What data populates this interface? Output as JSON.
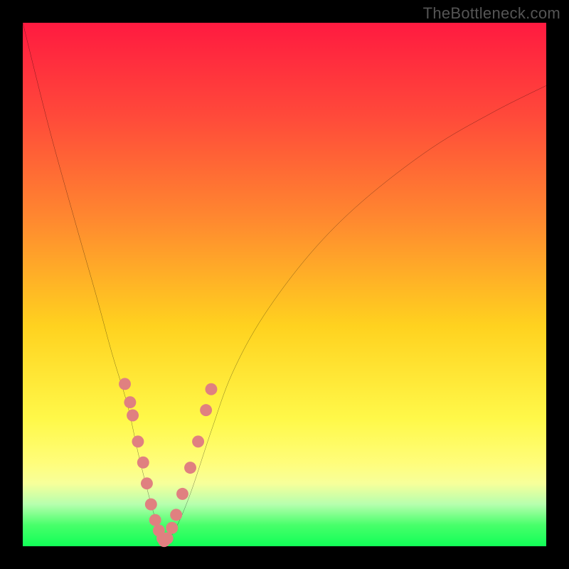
{
  "watermark": "TheBottleneck.com",
  "colors": {
    "background": "#000000",
    "curve_stroke": "#000000",
    "dot_fill": "#e08080",
    "gradient_top": "#ff1a40",
    "gradient_bottom": "#11ff57"
  },
  "chart_data": {
    "type": "line",
    "title": "",
    "xlabel": "",
    "ylabel": "",
    "xlim": [
      0,
      100
    ],
    "ylim": [
      0,
      100
    ],
    "series": [
      {
        "name": "bottleneck-curve",
        "x": [
          0,
          5,
          10,
          14,
          17,
          20,
          22,
          24,
          26,
          27,
          29,
          32,
          36,
          40,
          46,
          55,
          65,
          78,
          90,
          100
        ],
        "values": [
          100,
          80,
          62,
          48,
          37,
          27,
          18,
          10,
          3,
          1,
          3,
          10,
          22,
          33,
          44,
          56,
          66,
          76,
          83,
          88
        ]
      }
    ],
    "scatter_points": {
      "name": "highlighted-points",
      "x": [
        19.5,
        20.5,
        21,
        22,
        23,
        23.7,
        24.5,
        25.3,
        26,
        26.7,
        27,
        27.6,
        28.5,
        29.3,
        30.5,
        32,
        33.5,
        35,
        36
      ],
      "values": [
        31,
        27.5,
        25,
        20,
        16,
        12,
        8,
        5,
        3,
        1.5,
        1,
        1.5,
        3.5,
        6,
        10,
        15,
        20,
        26,
        30
      ]
    },
    "notes": "V-shaped bottleneck curve over a red-to-green vertical gradient. Minimum occurs near x≈27 at y≈1. Axis tick labels are not shown in the image; x and y are expressed as percentage of plot width/height from bottom-left."
  }
}
